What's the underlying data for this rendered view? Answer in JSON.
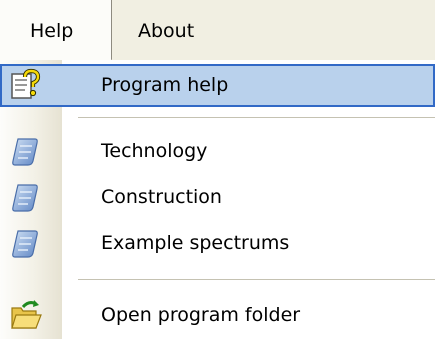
{
  "menubar": {
    "help_label": "Help",
    "about_label": "About"
  },
  "dropdown": {
    "items": [
      {
        "label": "Program help",
        "icon": "help-document-icon",
        "highlighted": true
      },
      {
        "label": "Technology",
        "icon": "scroll-icon"
      },
      {
        "label": "Construction",
        "icon": "scroll-icon"
      },
      {
        "label": "Example spectrums",
        "icon": "scroll-icon"
      },
      {
        "label": "Open program folder",
        "icon": "open-folder-icon"
      }
    ]
  },
  "colors": {
    "menubar_bg": "#f1efe2",
    "highlight_bg": "#b9d1ec",
    "highlight_border": "#3169c6"
  }
}
